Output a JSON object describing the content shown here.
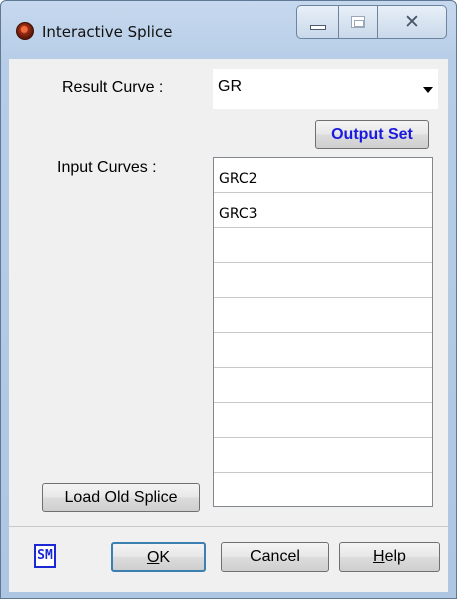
{
  "window": {
    "title": "Interactive Splice",
    "close_glyph": "✕",
    "icon_names": [
      "app-logo-icon",
      "minimize-icon",
      "maximize-icon",
      "close-icon"
    ]
  },
  "form": {
    "result_curve_label": "Result Curve :",
    "result_curve_value": "GR",
    "output_set_button": "Output Set",
    "input_curves_label": "Input Curves :",
    "input_curves": [
      "GRC2",
      "GRC3",
      "",
      "",
      "",
      "",
      "",
      "",
      "",
      ""
    ],
    "load_old_splice_button": "Load Old Splice"
  },
  "footer": {
    "logo_text": "SM",
    "ok_label_accel": "O",
    "ok_label_rest": "K",
    "cancel_label": "Cancel",
    "help_label_accel": "H",
    "help_label_rest": "elp"
  },
  "colors": {
    "title_bar": "#b7cde7",
    "output_set_text": "#1a1adf",
    "logo": "#1c27d6",
    "default_button_border": "#3c7fb1"
  }
}
